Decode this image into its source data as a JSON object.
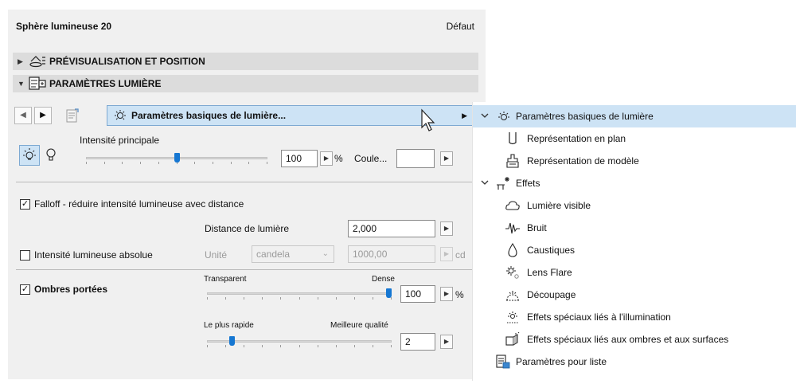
{
  "header": {
    "title": "Sphère lumineuse 20",
    "right_label": "Défaut"
  },
  "sections": {
    "preview": {
      "label": "PRÉVISUALISATION ET POSITION",
      "expanded": false
    },
    "light": {
      "label": "PARAMÈTRES LUMIÈRE",
      "expanded": true
    }
  },
  "toolbar": {
    "prev_icon": "triangle-left-icon",
    "next_icon": "triangle-right-icon",
    "preset_label": "Paramètres basiques de lumière..."
  },
  "intensity": {
    "label": "Intensité principale",
    "value": "100",
    "unit": "%",
    "slider_fraction": 0.5,
    "color_label": "Coule...",
    "color_value": "#ffffff"
  },
  "falloff": {
    "checked": true,
    "label": "Falloff - réduire intensité lumineuse avec distance"
  },
  "distance": {
    "label": "Distance de lumière",
    "value": "2,000"
  },
  "absolute": {
    "checked": false,
    "label": "Intensité lumineuse absolue",
    "unit_label": "Unité",
    "unit_value": "candela",
    "value": "1000,00",
    "unit_suffix": "cd"
  },
  "shadows": {
    "checked": true,
    "label": "Ombres portées",
    "transparency": {
      "left_label": "Transparent",
      "right_label": "Dense",
      "value": "100",
      "unit": "%",
      "slider_fraction": 1.0
    },
    "quality": {
      "left_label": "Le plus rapide",
      "right_label": "Meilleure qualité",
      "value": "2",
      "slider_fraction": 0.125
    }
  },
  "tree": {
    "items": [
      {
        "label": "Paramètres basiques de lumière",
        "icon": "bulb-rays-icon",
        "level": 0,
        "expandable": true,
        "expanded": true,
        "selected": true
      },
      {
        "label": "Représentation en plan",
        "icon": "plan-icon",
        "level": 1
      },
      {
        "label": "Représentation de modèle",
        "icon": "model-icon",
        "level": 1
      },
      {
        "label": "Effets",
        "icon": "effects-icon",
        "level": 0,
        "expandable": true,
        "expanded": true
      },
      {
        "label": "Lumière visible",
        "icon": "cloud-icon",
        "level": 1
      },
      {
        "label": "Bruit",
        "icon": "noise-icon",
        "level": 1
      },
      {
        "label": "Caustiques",
        "icon": "drop-icon",
        "level": 1
      },
      {
        "label": "Lens Flare",
        "icon": "lens-flare-icon",
        "level": 1
      },
      {
        "label": "Découpage",
        "icon": "clipping-icon",
        "level": 1
      },
      {
        "label": "Effets spéciaux liés à l'illumination",
        "icon": "illumination-fx-icon",
        "level": 1
      },
      {
        "label": "Effets spéciaux liés aux ombres et aux surfaces",
        "icon": "shadow-surface-fx-icon",
        "level": 1
      },
      {
        "label": "Paramètres pour liste",
        "icon": "list-params-icon",
        "level": 0
      }
    ]
  }
}
